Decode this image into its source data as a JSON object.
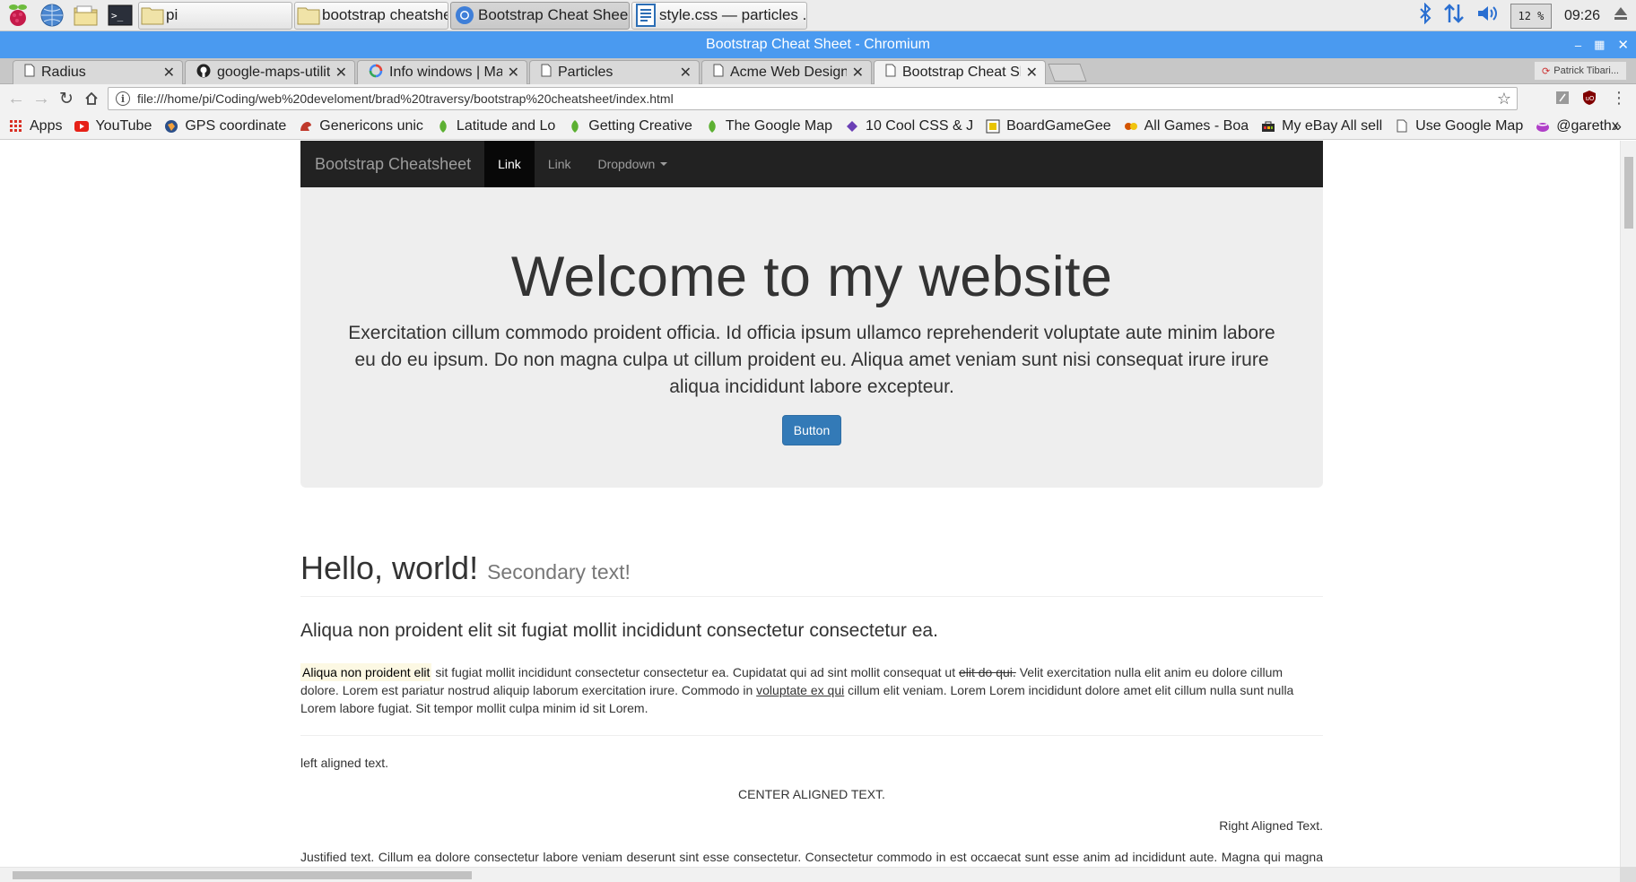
{
  "taskbar": {
    "launchers": [
      {
        "name": "raspberry-menu-icon"
      },
      {
        "name": "web-browser-icon"
      },
      {
        "name": "file-manager-icon"
      },
      {
        "name": "terminal-icon"
      }
    ],
    "tasks": [
      {
        "label": "pi",
        "icon": "folder-icon",
        "active": false
      },
      {
        "label": "bootstrap cheatsheet",
        "icon": "folder-icon",
        "active": false
      },
      {
        "label": "Bootstrap Cheat Shee...",
        "icon": "chromium-icon",
        "active": true
      },
      {
        "label": "style.css — particles ...",
        "icon": "text-editor-icon",
        "active": false
      }
    ],
    "cpu": "12 %",
    "clock": "09:26"
  },
  "window": {
    "title": "Bootstrap Cheat Sheet - Chromium"
  },
  "tabs": [
    {
      "label": "Radius",
      "icon": "page-icon",
      "active": false
    },
    {
      "label": "google-maps-utilit",
      "icon": "github-icon",
      "active": false
    },
    {
      "label": "Info windows | Ma",
      "icon": "google-dev-icon",
      "active": false
    },
    {
      "label": "Particles",
      "icon": "page-icon",
      "active": false
    },
    {
      "label": "Acme Web Design",
      "icon": "page-icon",
      "active": false
    },
    {
      "label": "Bootstrap Cheat Sh",
      "icon": "page-icon",
      "active": true
    }
  ],
  "profile": {
    "label": "Patrick Tibari..."
  },
  "omnibox": {
    "url": "file:///home/pi/Coding/web%20develoment/brad%20traversy/bootstrap%20cheatsheet/index.html"
  },
  "bookmarks": [
    {
      "label": "Apps",
      "icon": "apps-grid-icon"
    },
    {
      "label": "YouTube",
      "icon": "youtube-icon"
    },
    {
      "label": "GPS coordinate",
      "icon": "globe-icon"
    },
    {
      "label": "Genericons unic",
      "icon": "genericons-icon"
    },
    {
      "label": "Latitude and Lo",
      "icon": "leaf-icon"
    },
    {
      "label": "Getting Creative",
      "icon": "leaf-icon"
    },
    {
      "label": "The Google Map",
      "icon": "leaf-icon"
    },
    {
      "label": "10 Cool CSS & J",
      "icon": "bookmark-icon"
    },
    {
      "label": "BoardGameGee",
      "icon": "boardgame-icon"
    },
    {
      "label": "All Games - Boa",
      "icon": "games-icon"
    },
    {
      "label": "My eBay All sell",
      "icon": "ebay-icon"
    },
    {
      "label": "Use Google Map",
      "icon": "page-icon"
    },
    {
      "label": "@garethx",
      "icon": "twitter-icon"
    }
  ],
  "site": {
    "brand": "Bootstrap Cheatsheet",
    "nav": [
      {
        "label": "Link",
        "active": true
      },
      {
        "label": "Link",
        "active": false
      }
    ],
    "dropdown": "Dropdown",
    "jumbotron": {
      "heading": "Welcome to my website",
      "text": "Exercitation cillum commodo proident officia. Id officia ipsum ullamco reprehenderit voluptate aute minim labore eu do eu ipsum. Do non magna culpa ut cillum proident eu. Aliqua amet veniam sunt nisi consequat irure irure aliqua incididunt labore excepteur.",
      "button": "Button"
    },
    "hello": {
      "heading": "Hello, world!",
      "secondary": "Secondary text!"
    },
    "lead": "Aliqua non proident elit sit fugiat mollit incididunt consectetur consectetur ea.",
    "para": {
      "mark": "Aliqua non proident elit",
      "part1": " sit fugiat mollit incididunt consectetur consectetur ea. Cupidatat qui ad sint mollit consequat ut ",
      "del": "elit do qui.",
      "part2": " Velit exercitation nulla elit anim eu dolore cillum dolore. Lorem est pariatur nostrud aliquip laborum exercitation irure. Commodo in ",
      "underline": "voluptate ex qui",
      "part3": " cillum elit veniam. Lorem Lorem incididunt dolore amet elit cillum nulla sunt nulla Lorem labore fugiat. Sit tempor mollit culpa minim id sit Lorem."
    },
    "alignment": {
      "left": "left aligned text.",
      "center": "CENTER ALIGNED TEXT.",
      "right": "Right Aligned Text.",
      "justify": "Justified text. Cillum ea dolore consectetur labore veniam deserunt sint esse consectetur. Consectetur commodo in est occaecat sunt esse anim ad incididunt aute. Magna qui magna sunt proident mollit ut et enim voluptate in est duis. Sit qui sunt do Lorem laboris labore aute aliquip.Laborum laboris do non occaecat officia consequat enim. Id proident"
    }
  }
}
